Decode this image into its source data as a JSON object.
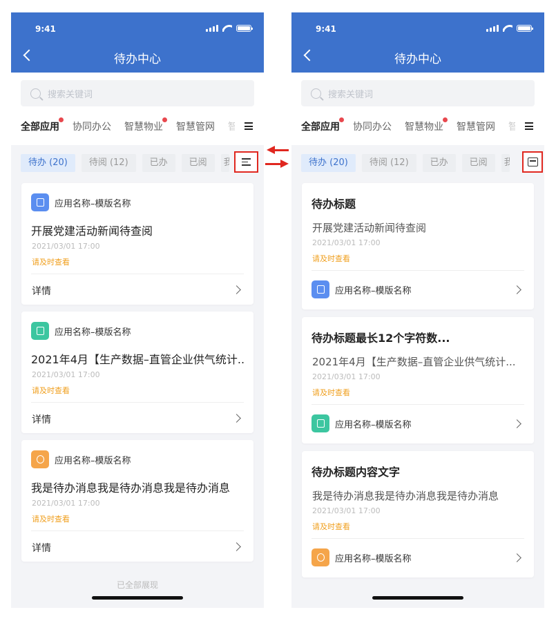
{
  "status_bar": {
    "time": "9:41"
  },
  "header": {
    "title": "待办中心"
  },
  "search": {
    "placeholder": "搜索关键词"
  },
  "categories": [
    {
      "label": "全部应用",
      "active": true,
      "badge": true
    },
    {
      "label": "协同办公",
      "active": false,
      "badge": false
    },
    {
      "label": "智慧物业",
      "active": false,
      "badge": true
    },
    {
      "label": "智慧管网",
      "active": false,
      "badge": false
    },
    {
      "label": "智",
      "active": false,
      "badge": false
    }
  ],
  "filters": [
    {
      "label": "待办 (20)",
      "active": true
    },
    {
      "label": "待阅 (12)",
      "active": false
    },
    {
      "label": "已办",
      "active": false
    },
    {
      "label": "已阅",
      "active": false
    },
    {
      "label": "我",
      "active": false
    }
  ],
  "colors": {
    "header": "#3d72cc",
    "badge": "#e8484e",
    "hint": "#f0a020",
    "highlight": "#e0271f",
    "icon_blue": "#5b8ef0",
    "icon_green": "#3cc6a0",
    "icon_orange": "#f5a54a"
  },
  "left_view": {
    "toggle_icon": "list-view-icon",
    "detail_label": "详情",
    "cards": [
      {
        "app": "应用名称–模版名称",
        "icon": "calendar-icon",
        "icon_color": "#5b8ef0",
        "title": "开展党建活动新闻待查阅",
        "time": "2021/03/01  17:00",
        "hint": "请及时查看"
      },
      {
        "app": "应用名称–模版名称",
        "icon": "clipboard-icon",
        "icon_color": "#3cc6a0",
        "title": "2021年4月【生产数据–直管企业供气统计...",
        "time": "2021/03/01  17:00",
        "hint": "请及时查看"
      },
      {
        "app": "应用名称–模版名称",
        "icon": "money-bag-icon",
        "icon_color": "#f5a54a",
        "title": "我是待办消息我是待办消息我是待办消息",
        "time": "2021/03/01  17:00",
        "hint": "请及时查看"
      }
    ],
    "footer": "已全部展现"
  },
  "right_view": {
    "toggle_icon": "card-view-icon",
    "cards": [
      {
        "heading": "待办标题",
        "subtitle": "开展党建活动新闻待查阅",
        "time": "2021/03/01  17:00",
        "hint": "请及时查看",
        "app": "应用名称–模版名称",
        "icon": "calendar-icon",
        "icon_color": "#5b8ef0"
      },
      {
        "heading": "待办标题最长12个字符数...",
        "subtitle": "2021年4月【生产数据–直管企业供气统计...",
        "time": "2021/03/01  17:00",
        "hint": "请及时查看",
        "app": "应用名称–模版名称",
        "icon": "clipboard-icon",
        "icon_color": "#3cc6a0"
      },
      {
        "heading": "待办标题内容文字",
        "subtitle": "我是待办消息我是待办消息我是待办消息",
        "time": "2021/03/01  17:00",
        "hint": "请及时查看",
        "app": "应用名称–模版名称",
        "icon": "money-bag-icon",
        "icon_color": "#f5a54a"
      }
    ]
  }
}
